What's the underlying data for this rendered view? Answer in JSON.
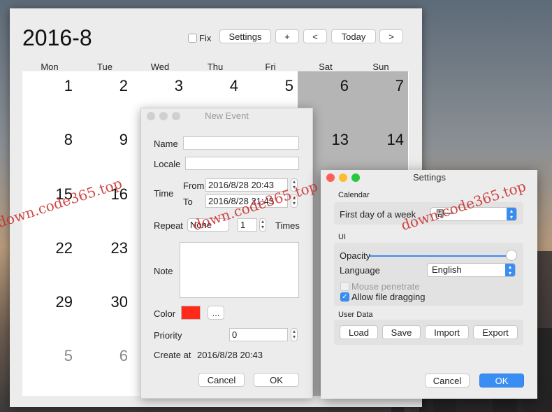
{
  "calendar": {
    "title": "2016-8",
    "fix_label": "Fix",
    "settings_label": "Settings",
    "add_label": "+",
    "prev_label": "<",
    "today_label": "Today",
    "next_label": ">",
    "weekdays": [
      "Mon",
      "Tue",
      "Wed",
      "Thu",
      "Fri",
      "Sat",
      "Sun"
    ],
    "days": [
      [
        "1",
        "2",
        "3",
        "4",
        "5",
        "6",
        "7"
      ],
      [
        "8",
        "9",
        "",
        "",
        "",
        "13",
        "14"
      ],
      [
        "15",
        "16",
        "",
        "",
        "",
        "",
        ""
      ],
      [
        "22",
        "23",
        "",
        "",
        "",
        "",
        ""
      ],
      [
        "29",
        "30",
        "",
        "",
        "",
        "",
        ""
      ],
      [
        "5",
        "6",
        "",
        "",
        "",
        "",
        ""
      ]
    ]
  },
  "new_event": {
    "title": "New Event",
    "name_label": "Name",
    "name_value": "",
    "locale_label": "Locale",
    "locale_value": "",
    "time_label": "Time",
    "from_label": "From",
    "from_value": "2016/8/28 20:43",
    "to_label": "To",
    "to_value": "2016/8/28 21:43",
    "repeat_label": "Repeat",
    "repeat_value": "None",
    "repeat_count": "1",
    "times_label": "Times",
    "note_label": "Note",
    "color_label": "Color",
    "color_value": "#ff2a1a",
    "color_more_label": "...",
    "priority_label": "Priority",
    "priority_value": "0",
    "create_label": "Create at",
    "create_value": "2016/8/28 20:43",
    "cancel_label": "Cancel",
    "ok_label": "OK"
  },
  "settings": {
    "title": "Settings",
    "calendar_section": "Calendar",
    "first_day_label": "First day of a week",
    "first_day_value": "周一",
    "ui_section": "UI",
    "opacity_label": "Opacity",
    "opacity_value": 1.0,
    "language_label": "Language",
    "language_value": "English",
    "mouse_penetrate_label": "Mouse penetrate",
    "allow_drag_label": "Allow file dragging",
    "user_data_section": "User Data",
    "load_label": "Load",
    "save_label": "Save",
    "import_label": "Import",
    "export_label": "Export",
    "cancel_label": "Cancel",
    "ok_label": "OK"
  },
  "watermark": "down.code365.top",
  "colors": {
    "accent": "#3a8ef3",
    "weekend": "#b5b5b5"
  }
}
